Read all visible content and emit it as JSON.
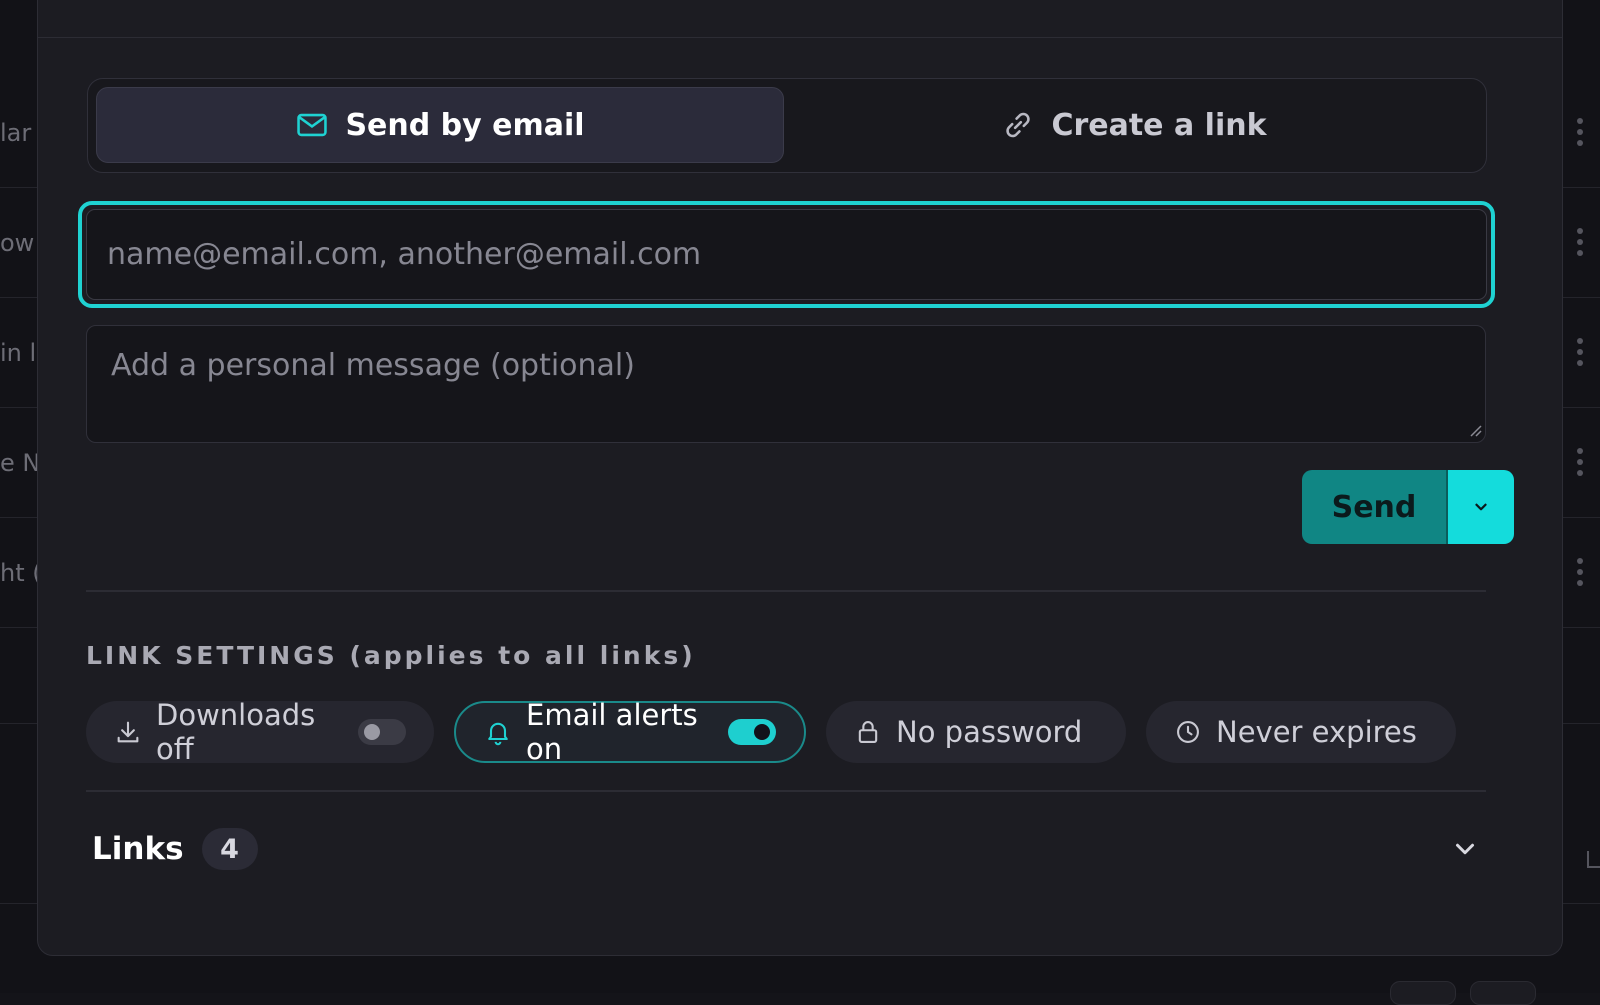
{
  "background": {
    "rows": [
      {
        "text": "lar"
      },
      {
        "text": "ow"
      },
      {
        "text": "in l"
      },
      {
        "text": "e N"
      },
      {
        "text": "ht ("
      }
    ]
  },
  "tabs": {
    "email_label": "Send by email",
    "link_label": "Create a link",
    "active": "email"
  },
  "email_input": {
    "placeholder": "name@email.com, another@email.com",
    "value": ""
  },
  "message_input": {
    "placeholder": "Add a personal message (optional)",
    "value": ""
  },
  "send": {
    "label": "Send"
  },
  "link_settings": {
    "title": "LINK SETTINGS (applies to all links)",
    "chips": [
      {
        "label": "Downloads off",
        "icon": "download-icon",
        "toggle": false
      },
      {
        "label": "Email alerts on",
        "icon": "bell-icon",
        "toggle": true
      },
      {
        "label": "No password",
        "icon": "lock-icon"
      },
      {
        "label": "Never expires",
        "icon": "clock-icon"
      }
    ]
  },
  "links": {
    "label": "Links",
    "count": "4"
  },
  "colors": {
    "accent": "#1fd2d2",
    "send_button": "#108684",
    "modal_bg": "#1c1c22"
  }
}
